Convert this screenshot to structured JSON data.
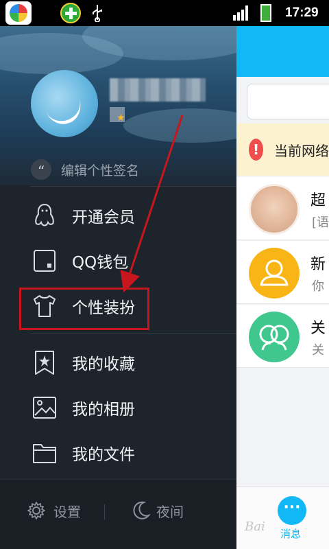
{
  "status_bar": {
    "time": "17:29",
    "icons": [
      "app-store-icon",
      "plus-icon",
      "usb-icon",
      "signal-icon",
      "battery-icon"
    ]
  },
  "drawer": {
    "signature_placeholder": "编辑个性签名",
    "quote_glyph": "“",
    "menu": [
      {
        "label": "开通会员",
        "icon": "penguin-icon"
      },
      {
        "label": "QQ钱包",
        "icon": "wallet-icon"
      },
      {
        "label": "个性装扮",
        "icon": "tshirt-icon"
      },
      {
        "label": "我的收藏",
        "icon": "bookmark-star-icon"
      },
      {
        "label": "我的相册",
        "icon": "photo-icon"
      },
      {
        "label": "我的文件",
        "icon": "folder-icon"
      }
    ],
    "footer": {
      "settings_label": "设置",
      "night_label": "夜间"
    },
    "highlighted_item": "个性装扮"
  },
  "main": {
    "warning_text": "当前网络",
    "warning_glyph": "!",
    "conversations": [
      {
        "title": "超",
        "subtitle": "[语"
      },
      {
        "title": "新",
        "subtitle": "你"
      },
      {
        "title": "关",
        "subtitle": "关"
      }
    ],
    "bottom_nav": {
      "messages_label": "消息",
      "messages_glyph": "···"
    },
    "watermark": "Bai"
  },
  "colors": {
    "accent_blue": "#12b7f5",
    "highlight_red": "#c8161d",
    "warning_bg": "#fdf2cf",
    "drawer_bg": "#1e242b"
  }
}
